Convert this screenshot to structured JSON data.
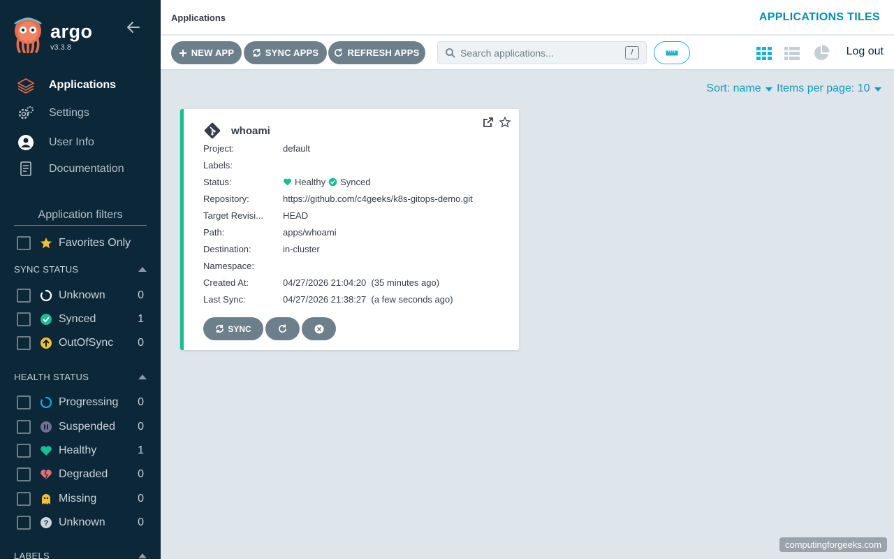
{
  "sidebar": {
    "brand": "argo",
    "version": "v3.3.8",
    "nav": [
      {
        "label": "Applications",
        "icon": "layers-icon",
        "active": true
      },
      {
        "label": "Settings",
        "icon": "gears-icon"
      },
      {
        "label": "User Info",
        "icon": "user-circle-icon"
      },
      {
        "label": "Documentation",
        "icon": "book-icon"
      }
    ],
    "filters_title": "Application filters",
    "favorites_label": "Favorites Only",
    "sync_status": {
      "title": "SYNC STATUS",
      "items": [
        {
          "label": "Unknown",
          "count": "0",
          "icon": "circle-notch-icon"
        },
        {
          "label": "Synced",
          "count": "1",
          "icon": "check-circle-icon"
        },
        {
          "label": "OutOfSync",
          "count": "0",
          "icon": "arrow-up-circle-icon"
        }
      ]
    },
    "health_status": {
      "title": "HEALTH STATUS",
      "items": [
        {
          "label": "Progressing",
          "count": "0",
          "icon": "spinner-icon"
        },
        {
          "label": "Suspended",
          "count": "0",
          "icon": "pause-circle-icon"
        },
        {
          "label": "Healthy",
          "count": "1",
          "icon": "heart-icon"
        },
        {
          "label": "Degraded",
          "count": "0",
          "icon": "heart-broken-icon"
        },
        {
          "label": "Missing",
          "count": "0",
          "icon": "ghost-icon"
        },
        {
          "label": "Unknown",
          "count": "0",
          "icon": "question-circle-icon"
        }
      ]
    },
    "labels_title": "LABELS"
  },
  "header": {
    "breadcrumb": "Applications",
    "title": "APPLICATIONS TILES"
  },
  "toolbar": {
    "new_app": "NEW APP",
    "sync_apps": "SYNC APPS",
    "refresh_apps": "REFRESH APPS",
    "search_placeholder": "Search applications...",
    "search_shortcut": "/",
    "logout": "Log out"
  },
  "sort": {
    "sort_label": "Sort: name",
    "per_page_label": "Items per page: 10"
  },
  "app_card": {
    "name": "whoami",
    "fields": [
      {
        "key": "Project:",
        "value": "default"
      },
      {
        "key": "Labels:",
        "value": ""
      },
      {
        "key": "Status:",
        "health": "Healthy",
        "sync": "Synced"
      },
      {
        "key": "Repository:",
        "value": "https://github.com/c4geeks/k8s-gitops-demo.git"
      },
      {
        "key": "Target Revisi...",
        "value": "HEAD"
      },
      {
        "key": "Path:",
        "value": "apps/whoami"
      },
      {
        "key": "Destination:",
        "value": "in-cluster"
      },
      {
        "key": "Namespace:",
        "value": ""
      },
      {
        "key": "Created At:",
        "value": "04/27/2026 21:04:20  (35 minutes ago)"
      },
      {
        "key": "Last Sync:",
        "value": "04/27/2026 21:38:27  (a few seconds ago)"
      }
    ],
    "sync_button": "SYNC"
  },
  "watermark": "computingforgeeks.com",
  "colors": {
    "sidebar_bg": "#0c2738",
    "accent": "#0d8cab",
    "healthy": "#18be94",
    "button_gray": "#6d7f8b"
  }
}
